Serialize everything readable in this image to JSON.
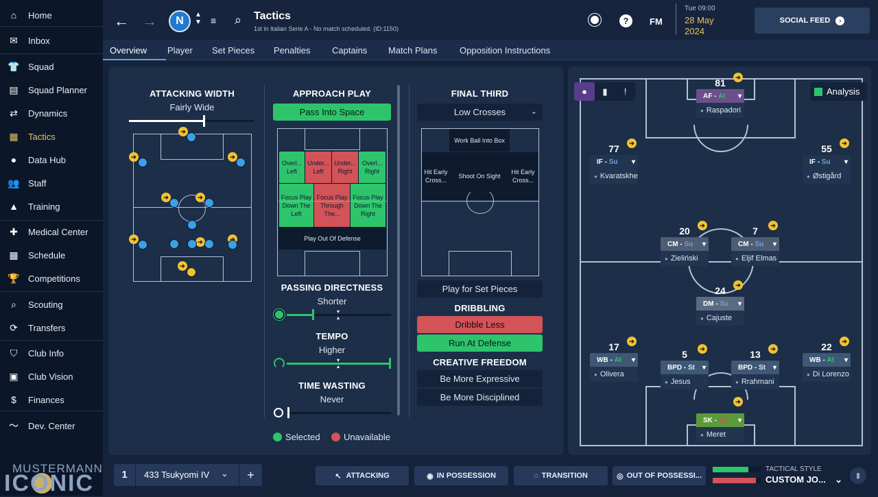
{
  "sidebar": {
    "items": [
      {
        "label": "Home",
        "icon": "home-icon",
        "glyph": "⌂"
      },
      {
        "label": "Inbox",
        "icon": "inbox-icon",
        "glyph": "✉"
      },
      {
        "label": "Squad",
        "icon": "shirt-icon",
        "glyph": "👕"
      },
      {
        "label": "Squad Planner",
        "icon": "clipboard-icon",
        "glyph": "▤"
      },
      {
        "label": "Dynamics",
        "icon": "dynamics-icon",
        "glyph": "⇄"
      },
      {
        "label": "Tactics",
        "icon": "tactics-board-icon",
        "glyph": "▦"
      },
      {
        "label": "Data Hub",
        "icon": "data-hub-icon",
        "glyph": "●"
      },
      {
        "label": "Staff",
        "icon": "staff-icon",
        "glyph": "👥"
      },
      {
        "label": "Training",
        "icon": "training-cone-icon",
        "glyph": "▲"
      },
      {
        "label": "Medical Center",
        "icon": "medical-icon",
        "glyph": "✚"
      },
      {
        "label": "Schedule",
        "icon": "calendar-icon",
        "glyph": "▦"
      },
      {
        "label": "Competitions",
        "icon": "trophy-icon",
        "glyph": "🏆"
      },
      {
        "label": "Scouting",
        "icon": "scouting-search-icon",
        "glyph": "⌕"
      },
      {
        "label": "Transfers",
        "icon": "transfers-icon",
        "glyph": "⟳"
      },
      {
        "label": "Club Info",
        "icon": "shield-icon",
        "glyph": "⛉"
      },
      {
        "label": "Club Vision",
        "icon": "briefcase-icon",
        "glyph": "▣"
      },
      {
        "label": "Finances",
        "icon": "finances-icon",
        "glyph": "$"
      },
      {
        "label": "Dev. Center",
        "icon": "dev-center-icon",
        "glyph": "〜"
      }
    ],
    "brand_line1": "MUSTERMANN",
    "brand_line2": "ICONIC"
  },
  "header": {
    "title": "Tactics",
    "subtitle": "1st in Italian Serie A - No match scheduled. (ID:1150)",
    "time": "Tue 09:00",
    "date": "28 May",
    "year": "2024",
    "fm_label": "FM",
    "social_feed": "SOCIAL FEED"
  },
  "tabs": [
    "Overview",
    "Player",
    "Set Pieces",
    "Penalties",
    "Captains",
    "Match Plans",
    "Opposition Instructions"
  ],
  "attacking_width": {
    "title": "ATTACKING WIDTH",
    "value": "Fairly Wide",
    "level": 0.6
  },
  "approach_play": {
    "title": "APPROACH PLAY",
    "selected": "Pass Into Space",
    "zones": {
      "overlap_left": "Overl... Left",
      "underlap_left": "Under... Left",
      "underlap_right": "Under... Right",
      "overlap_right": "Overl... Right",
      "focus_left": "Focus Play Down The Left",
      "focus_through": "Focus Play Through The...",
      "focus_right": "Focus Play Down The Right",
      "play_out": "Play Out Of Defense"
    }
  },
  "passing_directness": {
    "title": "PASSING DIRECTNESS",
    "value": "Shorter"
  },
  "tempo": {
    "title": "TEMPO",
    "value": "Higher"
  },
  "time_wasting": {
    "title": "TIME WASTING",
    "value": "Never"
  },
  "final_third": {
    "title": "FINAL THIRD",
    "crossing": "Low Crosses",
    "work_ball": "Work Ball Into Box",
    "hit_early_left": "Hit Early Cross...",
    "shoot": "Shoot On Sight",
    "hit_early_right": "Hit Early Cross...",
    "set_pieces": "Play for Set Pieces"
  },
  "dribbling": {
    "title": "DRIBBLING",
    "less": "Dribble Less",
    "run_at": "Run At Defense"
  },
  "creative_freedom": {
    "title": "CREATIVE FREEDOM",
    "expressive": "Be More Expressive",
    "disciplined": "Be More Disciplined"
  },
  "legend": {
    "selected": "Selected",
    "unavailable": "Unavailable"
  },
  "analysis_label": "Analysis",
  "players": [
    {
      "num": "81",
      "role": "AF",
      "duty": "At",
      "name": "Raspadori"
    },
    {
      "num": "77",
      "role": "IF",
      "duty": "Su",
      "name": "Kvaratskhel.."
    },
    {
      "num": "55",
      "role": "IF",
      "duty": "Su",
      "name": "Østigård"
    },
    {
      "num": "20",
      "role": "CM",
      "duty": "Su",
      "name": "Zieliński"
    },
    {
      "num": "7",
      "role": "CM",
      "duty": "Su",
      "name": "Eljif Elmas"
    },
    {
      "num": "24",
      "role": "DM",
      "duty": "Su",
      "name": "Cajuste"
    },
    {
      "num": "17",
      "role": "WB",
      "duty": "At",
      "name": "Olivera"
    },
    {
      "num": "5",
      "role": "BPD",
      "duty": "St",
      "name": "Jesus"
    },
    {
      "num": "13",
      "role": "BPD",
      "duty": "St",
      "name": "Rrahmani"
    },
    {
      "num": "22",
      "role": "WB",
      "duty": "At",
      "name": "Di Lorenzo"
    },
    {
      "num": "",
      "role": "SK",
      "duty": "De",
      "name": "Meret"
    }
  ],
  "bottom": {
    "tactic_num": "1",
    "tactic_name": "433 Tsukyomi IV",
    "attacking": "ATTACKING",
    "in_possession": "IN POSSESSION",
    "transition": "TRANSITION",
    "out_possession": "OUT OF POSSESSI...",
    "style_label": "TACTICAL STYLE",
    "style_value": "CUSTOM JO..."
  }
}
